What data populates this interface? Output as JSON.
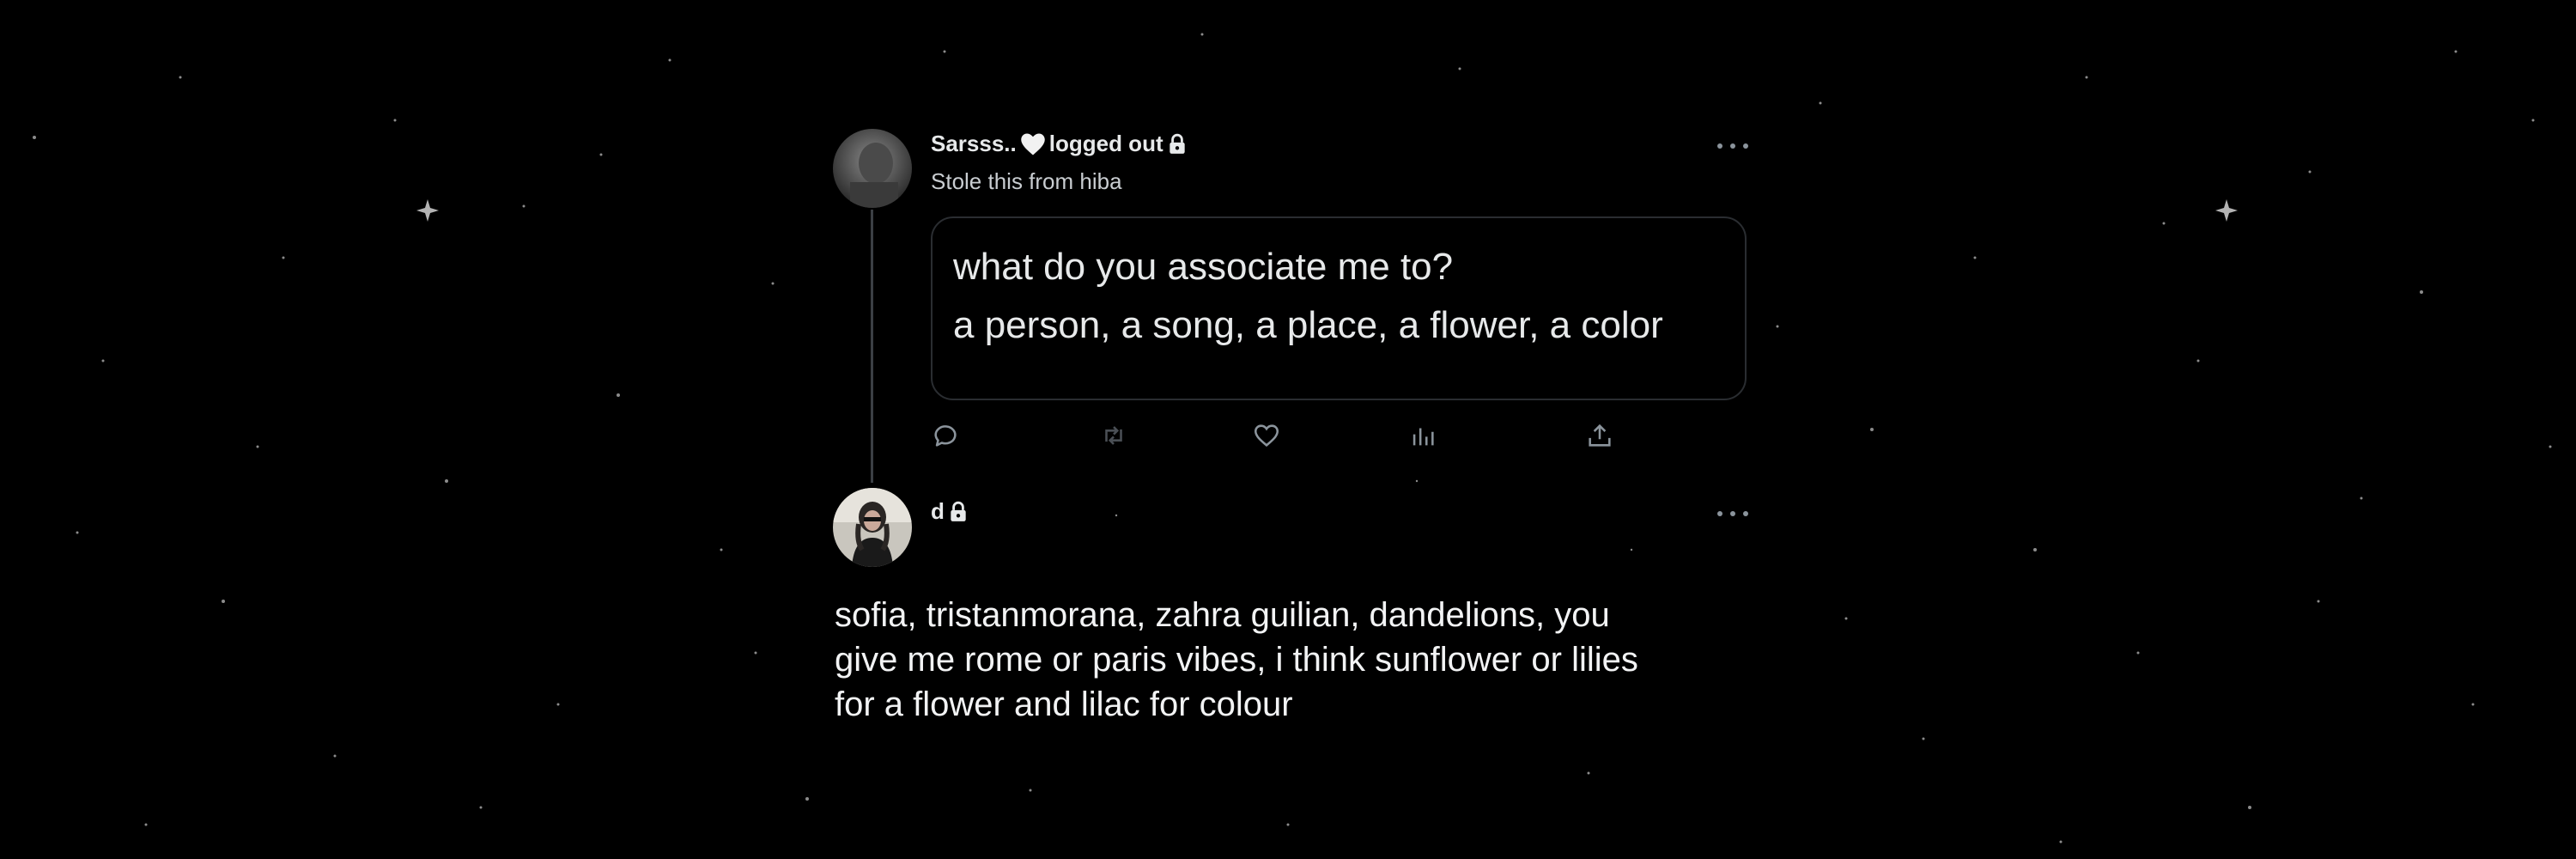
{
  "post": {
    "author_name": "Sarsss..",
    "author_status": "logged out",
    "subtitle": "Stole this from hiba",
    "quote_line_1": "what do you associate me to?",
    "quote_line_2": "a person, a song, a place, a flower, a color",
    "actions": [
      "reply-icon",
      "retweet-icon",
      "like-icon",
      "views-icon",
      "share-icon"
    ]
  },
  "reply": {
    "author_name": "d",
    "text_lines": [
      "sofia, tristanmorana, zahra guilian, dandelions, you",
      "give me rome or paris vibes, i think sunflower or lilies",
      "for a flower and lilac for colour"
    ]
  },
  "colors": {
    "background": "#000000",
    "text_primary": "#e7e9ea",
    "text_secondary": "#8b949c",
    "border": "#2a2d31"
  }
}
